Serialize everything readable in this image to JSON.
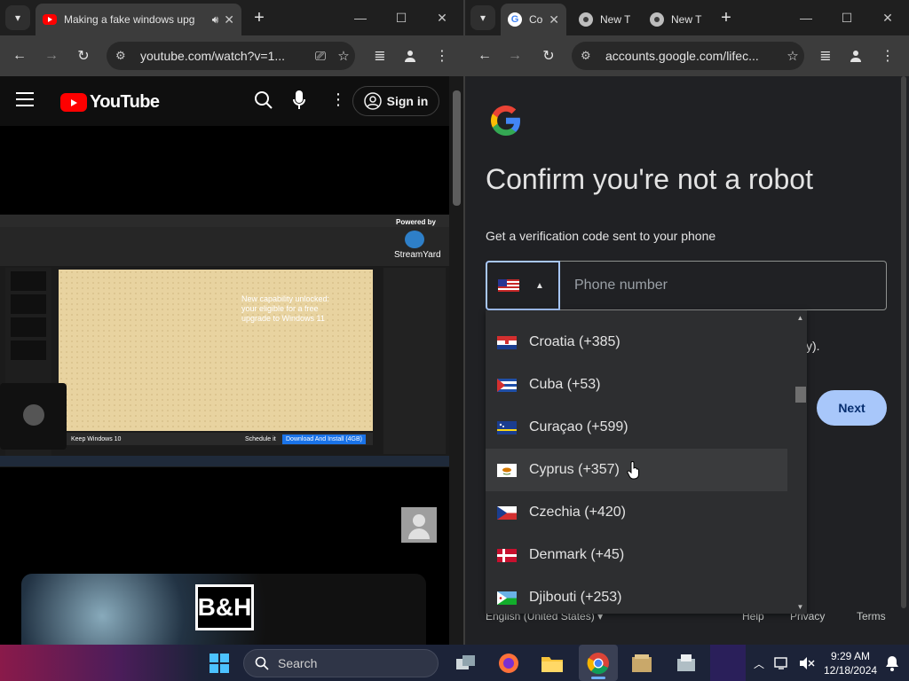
{
  "left_window": {
    "tab": {
      "title": "Making a fake windows upg",
      "favicon": "youtube-icon"
    },
    "url": "youtube.com/watch?v=1...",
    "youtube": {
      "logo_text": "YouTube",
      "sign_in_label": "Sign in"
    },
    "video": {
      "streamyard_label": "StreamYard",
      "powered_by": "Powered by",
      "slide_text": "New capability unlocked: your eligible for a free upgrade to Windows 11",
      "keep_label": "Keep Windows 10",
      "schedule_label": "Schedule it",
      "download_label": "Download And Install (4GB)"
    },
    "ad_logo": "B&H"
  },
  "right_window": {
    "tabs": [
      {
        "title": "Co",
        "favicon": "google-icon",
        "active": true
      },
      {
        "title": "New T",
        "favicon": "chrome-icon",
        "active": false
      },
      {
        "title": "New T",
        "favicon": "chrome-icon",
        "active": false
      }
    ],
    "url": "accounts.google.com/lifec...",
    "page": {
      "title": "Confirm you're not a robot",
      "subtitle": "Get a verification code sent to your phone",
      "phone_placeholder": "Phone number",
      "hidden_text_fragment": "y).",
      "next_label": "Next",
      "footer_language": "English (United States)",
      "footer_help": "Help",
      "footer_privacy": "Privacy",
      "footer_terms": "Terms"
    },
    "country_dropdown": {
      "items": [
        {
          "label": "Croatia (+385)",
          "flag": "croatia"
        },
        {
          "label": "Cuba (+53)",
          "flag": "cuba"
        },
        {
          "label": "Curaçao (+599)",
          "flag": "curacao"
        },
        {
          "label": "Cyprus (+357)",
          "flag": "cyprus",
          "hover": true
        },
        {
          "label": "Czechia (+420)",
          "flag": "czechia"
        },
        {
          "label": "Denmark (+45)",
          "flag": "denmark"
        },
        {
          "label": "Djibouti (+253)",
          "flag": "djibouti"
        }
      ]
    }
  },
  "taskbar": {
    "search_label": "Search",
    "time": "9:29 AM",
    "date": "12/18/2024"
  },
  "colors": {
    "accent_blue": "#a8c7fa",
    "youtube_red": "#ff0000"
  }
}
